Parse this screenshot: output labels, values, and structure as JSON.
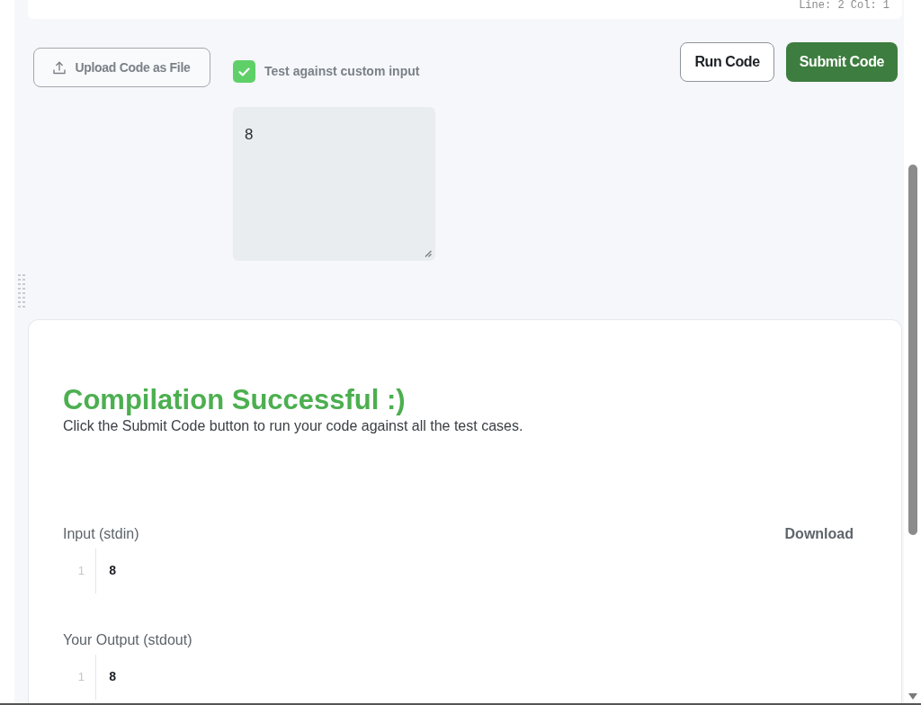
{
  "editor_status": {
    "text": "Line: 2 Col: 1"
  },
  "toolbar": {
    "upload_button": {
      "label": "Upload Code as File"
    },
    "custom_input": {
      "label": "Test against custom input",
      "checked": true
    },
    "buttons": [
      {
        "label": "Run Code",
        "kind": "secondary"
      },
      {
        "label": "Submit Code",
        "kind": "primary"
      }
    ]
  },
  "custom_input_box": {
    "value": "8"
  },
  "result": {
    "title": "Compilation Successful :)",
    "message": "Click the Submit Code button to run your code against all the test cases.",
    "sections": [
      {
        "label": "Input (stdin)",
        "action": "Download",
        "lines": [
          {
            "number": "1",
            "text": "8"
          }
        ]
      },
      {
        "label": "Your Output (stdout)",
        "lines": [
          {
            "number": "1",
            "text": "8"
          }
        ]
      }
    ]
  }
}
